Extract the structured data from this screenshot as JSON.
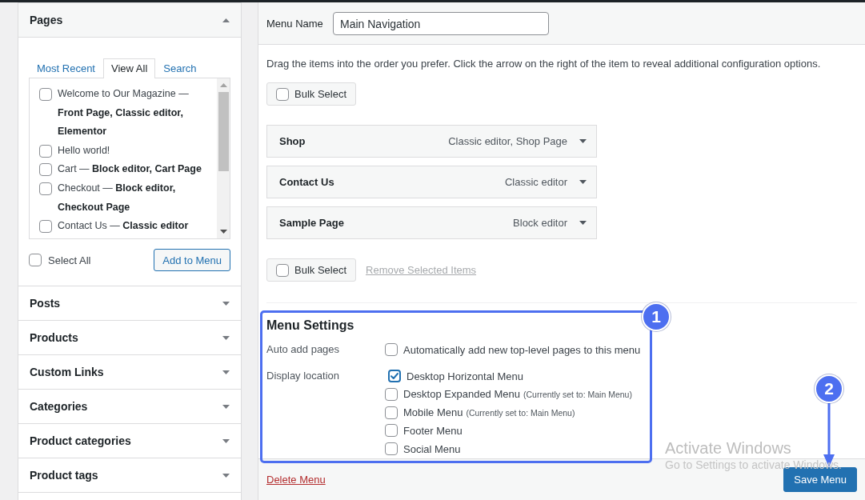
{
  "pages_panel": {
    "title": "Pages",
    "expanded": true,
    "tabs": [
      {
        "label": "Most Recent",
        "selected": false
      },
      {
        "label": "View All",
        "selected": true
      },
      {
        "label": "Search",
        "selected": false
      }
    ],
    "items": [
      {
        "label": "Welcome to Our Magazine — **Front Page, Classic editor, Elementor**",
        "checked": false
      },
      {
        "label": "Hello world!",
        "checked": false
      },
      {
        "label": "Cart — **Block editor, Cart Page**",
        "checked": false
      },
      {
        "label": "Checkout — **Block editor, Checkout Page**",
        "checked": false
      },
      {
        "label": "Contact Us — **Classic editor**",
        "checked": false
      }
    ],
    "select_all": {
      "label": "Select All",
      "checked": false
    },
    "add_button": "Add to Menu"
  },
  "sections": [
    {
      "title": "Posts",
      "expanded": false
    },
    {
      "title": "Products",
      "expanded": false
    },
    {
      "title": "Custom Links",
      "expanded": false
    },
    {
      "title": "Categories",
      "expanded": false
    },
    {
      "title": "Product categories",
      "expanded": false
    },
    {
      "title": "Product tags",
      "expanded": false
    }
  ],
  "menu_name": {
    "label": "Menu Name",
    "value": "Main Navigation"
  },
  "instructions": "Drag the items into the order you prefer. Click the arrow on the right of the item to reveal additional configuration options.",
  "bulk_select_top": {
    "label": "Bulk Select",
    "checked": false
  },
  "menu_items": [
    {
      "title": "Shop",
      "type": "Classic editor, Shop Page"
    },
    {
      "title": "Contact Us",
      "type": "Classic editor"
    },
    {
      "title": "Sample Page",
      "type": "Block editor"
    }
  ],
  "bulk_select_bottom": {
    "label": "Bulk Select",
    "checked": false
  },
  "remove_link": {
    "label": "Remove Selected Items",
    "disabled": true
  },
  "menu_settings": {
    "title": "Menu Settings",
    "rows": [
      {
        "label": "Auto add pages",
        "options": [
          {
            "label": "Automatically add new top-level pages to this menu",
            "checked": false
          }
        ]
      },
      {
        "label": "Display location",
        "options": [
          {
            "label": "Desktop Horizontal Menu",
            "checked": true
          },
          {
            "label": "Desktop Expanded Menu",
            "note": "(Currently set to: Main Menu)",
            "checked": false
          },
          {
            "label": "Mobile Menu",
            "note": "(Currently set to: Main Menu)",
            "checked": false
          },
          {
            "label": "Footer Menu",
            "checked": false
          },
          {
            "label": "Social Menu",
            "checked": false
          }
        ]
      }
    ]
  },
  "footer": {
    "delete_link": "Delete Menu",
    "save_button": "Save Menu"
  },
  "callouts": [
    {
      "number": "1",
      "kind": "frame"
    },
    {
      "number": "2",
      "kind": "arrow"
    }
  ],
  "activation_notice": {
    "title": "Activate Windows",
    "hint": "Go to Settings to activate Windows."
  }
}
